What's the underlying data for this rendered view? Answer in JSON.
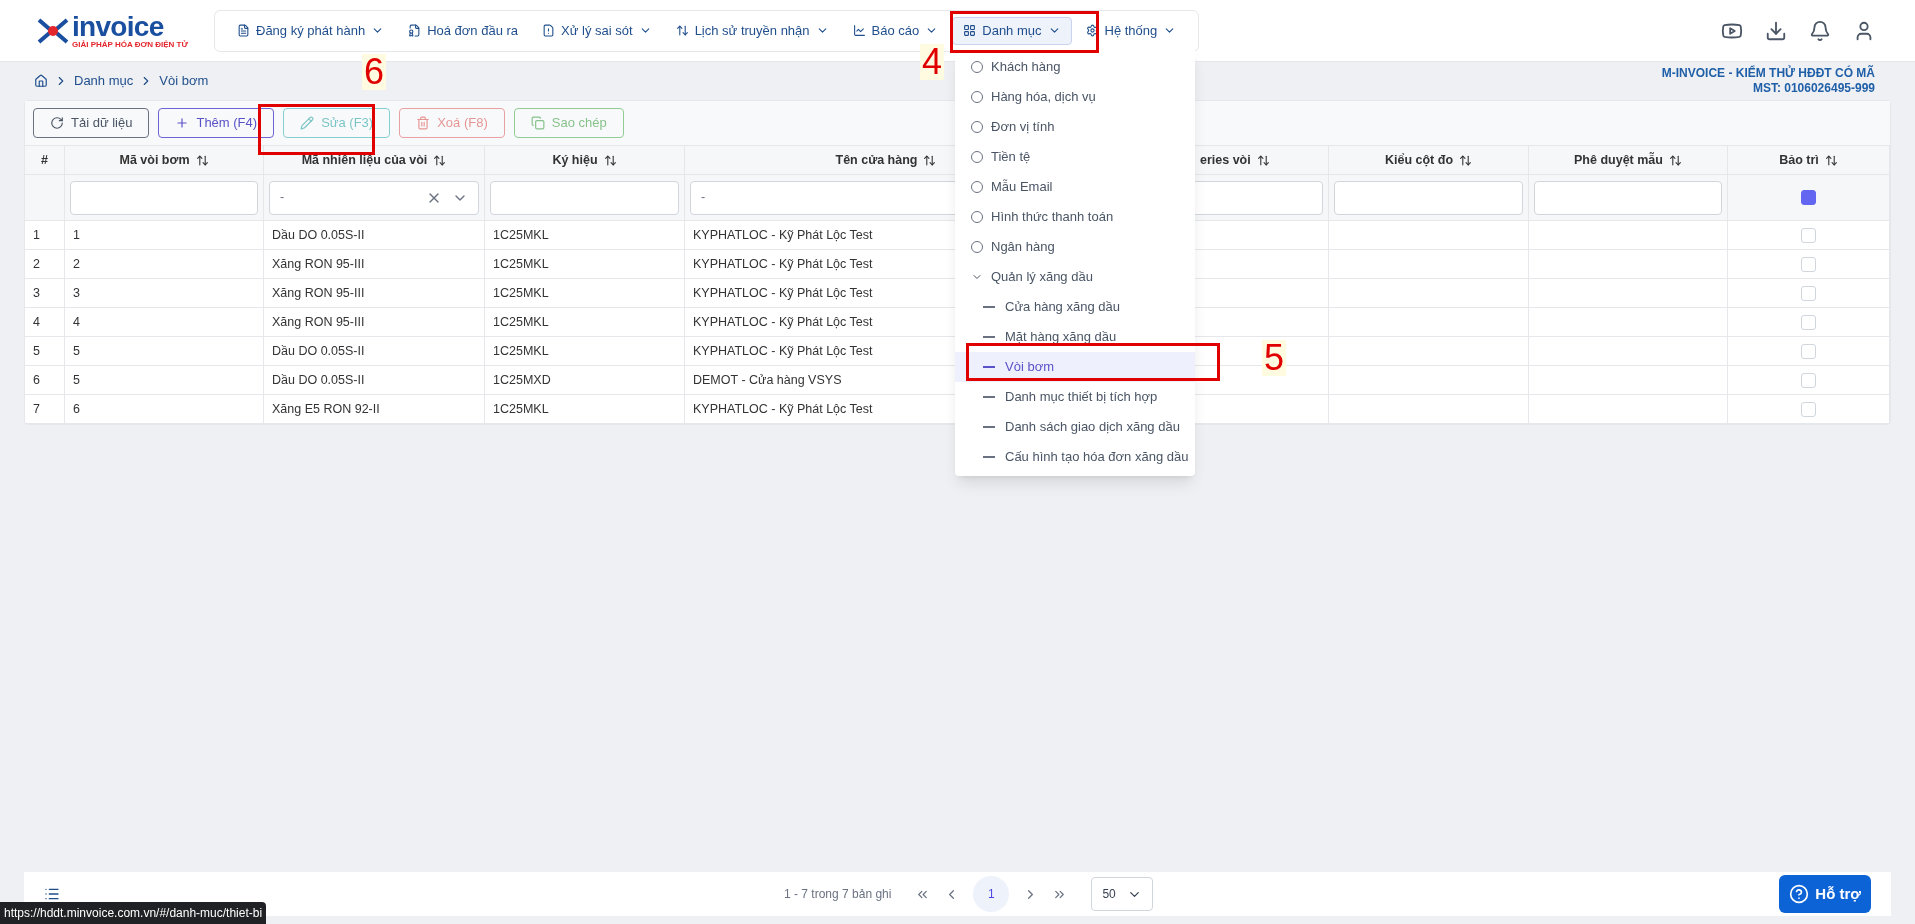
{
  "logo": {
    "name": "invoice",
    "tagline": "GIẢI PHÁP HÓA ĐƠN ĐIỆN TỬ"
  },
  "nav": [
    {
      "label": "Đăng ký phát hành",
      "dropdown": true,
      "selected": false
    },
    {
      "label": "Hoá đơn đầu ra",
      "dropdown": false,
      "selected": false
    },
    {
      "label": "Xử lý sai sót",
      "dropdown": true,
      "selected": false
    },
    {
      "label": "Lịch sử truyền nhận",
      "dropdown": true,
      "selected": false
    },
    {
      "label": "Báo cáo",
      "dropdown": true,
      "selected": false
    },
    {
      "label": "Danh mục",
      "dropdown": true,
      "selected": true
    },
    {
      "label": "Hệ thống",
      "dropdown": true,
      "selected": false
    }
  ],
  "breadcrumb": [
    "Danh mục",
    "Vòi bơm"
  ],
  "company": {
    "name": "M-INVOICE - KIỂM THỬ HĐĐT CÓ MÃ",
    "tax_id": "MST: 0106026495-999"
  },
  "toolbar": [
    {
      "kind": "reload",
      "label": "Tải dữ liệu",
      "disabled": false
    },
    {
      "kind": "add",
      "label": "Thêm (F4)",
      "disabled": false
    },
    {
      "kind": "edit",
      "label": "Sửa (F3)",
      "disabled": true
    },
    {
      "kind": "delete",
      "label": "Xoá (F8)",
      "disabled": true
    },
    {
      "kind": "copy",
      "label": "Sao chép",
      "disabled": true
    }
  ],
  "table": {
    "columns": [
      {
        "label": "#",
        "sortable": false,
        "kind": "none"
      },
      {
        "label": "Mã vòi bơm",
        "sortable": true,
        "kind": "text"
      },
      {
        "label": "Mã nhiên liệu của vòi",
        "sortable": true,
        "kind": "select",
        "placeholder": "-"
      },
      {
        "label": "Ký hiệu",
        "sortable": true,
        "kind": "text"
      },
      {
        "label": "Tên cửa hàng",
        "sortable": true,
        "kind": "covered",
        "placeholder": "-"
      },
      {
        "label": "eries vòi",
        "sortable": true,
        "kind": "text"
      },
      {
        "label": "Kiểu cột đo",
        "sortable": true,
        "kind": "text"
      },
      {
        "label": "Phê duyệt mẫu",
        "sortable": true,
        "kind": "text"
      },
      {
        "label": "Bảo trì",
        "sortable": true,
        "kind": "checkbox",
        "checked": true
      }
    ],
    "rows": [
      {
        "cells": [
          "1",
          "1",
          "Dầu DO 0.05S-II",
          "1C25MKL",
          "KYPHATLOC - Kỹ Phát Lộc Test"
        ],
        "checked": false
      },
      {
        "cells": [
          "2",
          "2",
          "Xăng RON 95-III",
          "1C25MKL",
          "KYPHATLOC - Kỹ Phát Lộc Test"
        ],
        "checked": false
      },
      {
        "cells": [
          "3",
          "3",
          "Xăng RON 95-III",
          "1C25MKL",
          "KYPHATLOC - Kỹ Phát Lộc Test"
        ],
        "checked": false
      },
      {
        "cells": [
          "4",
          "4",
          "Xăng RON 95-III",
          "1C25MKL",
          "KYPHATLOC - Kỹ Phát Lộc Test"
        ],
        "checked": false
      },
      {
        "cells": [
          "5",
          "5",
          "Dầu DO 0.05S-II",
          "1C25MKL",
          "KYPHATLOC - Kỹ Phát Lộc Test"
        ],
        "checked": false
      },
      {
        "cells": [
          "6",
          "5",
          "Dầu DO 0.05S-II",
          "1C25MXD",
          "DEMOT - Cửa hàng VSYS"
        ],
        "checked": false
      },
      {
        "cells": [
          "7",
          "6",
          "Xăng E5 RON 92-II",
          "1C25MKL",
          "KYPHATLOC - Kỹ Phát Lộc Test"
        ],
        "checked": false
      }
    ]
  },
  "menu": [
    {
      "kind": "item",
      "label": "Khách hàng"
    },
    {
      "kind": "item",
      "label": "Hàng hóa, dịch vụ"
    },
    {
      "kind": "item",
      "label": "Đơn vị tính"
    },
    {
      "kind": "item",
      "label": "Tiền tệ"
    },
    {
      "kind": "item",
      "label": "Mẫu Email"
    },
    {
      "kind": "item",
      "label": "Hình thức thanh toán"
    },
    {
      "kind": "item",
      "label": "Ngân hàng"
    },
    {
      "kind": "group",
      "label": "Quản lý xăng dầu",
      "expanded": true,
      "children": [
        {
          "label": "Cửa hàng xăng dầu",
          "selected": false
        },
        {
          "label": "Mặt hàng xăng dầu",
          "selected": false
        },
        {
          "label": "Vòi bơm",
          "selected": true
        },
        {
          "label": "Danh mục thiết bị tích hợp",
          "selected": false
        },
        {
          "label": "Danh sách giao dịch xăng dầu",
          "selected": false
        },
        {
          "label": "Cấu hình tạo hóa đơn xăng dầu",
          "selected": false
        }
      ]
    }
  ],
  "pagination": {
    "summary": "1 - 7 trong 7 bản ghi",
    "pages": [
      {
        "label": "1",
        "selected": true
      }
    ],
    "page_size": "50"
  },
  "help_button": "Hỗ trợ",
  "status_url": "https://hddt.minvoice.com.vn/#/danh-muc/thiet-bi",
  "annotations": [
    {
      "label": "4",
      "kind": "nav"
    },
    {
      "label": "5",
      "kind": "menu"
    },
    {
      "label": "6",
      "kind": "edit"
    }
  ]
}
